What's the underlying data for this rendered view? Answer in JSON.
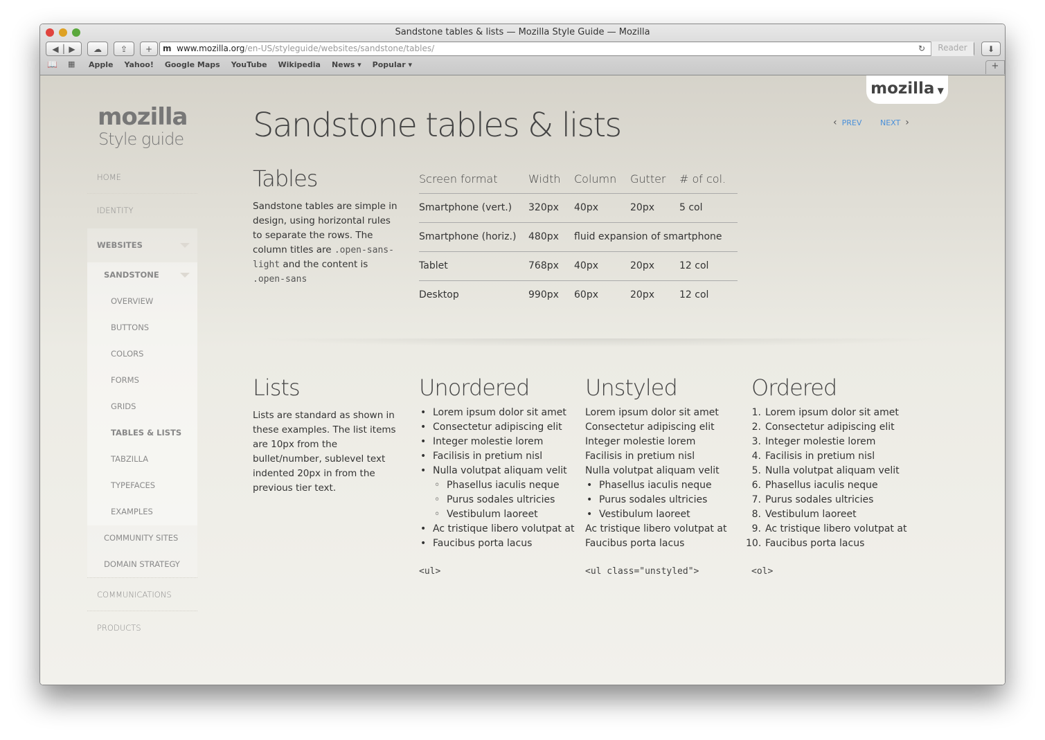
{
  "browser": {
    "title": "Sandstone tables & lists — Mozilla Style Guide — Mozilla",
    "url_domain": "www.mozilla.org",
    "url_path": "/en-US/styleguide/websites/sandstone/tables/",
    "reader": "Reader",
    "bookmarks": [
      "Apple",
      "Yahoo!",
      "Google Maps",
      "YouTube",
      "Wikipedia",
      "News ▾",
      "Popular ▾"
    ]
  },
  "tab": {
    "logo": "mozilla"
  },
  "sidebar": {
    "logo": "mozilla",
    "subtitle": "Style guide",
    "top": [
      "HOME",
      "IDENTITY"
    ],
    "websites": "WEBSITES",
    "sandstone": "SANDSTONE",
    "sandstone_items": [
      "OVERVIEW",
      "BUTTONS",
      "COLORS",
      "FORMS",
      "GRIDS",
      "TABLES & LISTS",
      "TABZILLA",
      "TYPEFACES",
      "EXAMPLES"
    ],
    "websites_items": [
      "COMMUNITY SITES",
      "DOMAIN STRATEGY"
    ],
    "bottom": [
      "COMMUNICATIONS",
      "PRODUCTS"
    ]
  },
  "page": {
    "title": "Sandstone tables & lists",
    "prev": "PREV",
    "next": "NEXT"
  },
  "tables": {
    "heading": "Tables",
    "desc1": "Sandstone tables are simple in design, using horizontal rules to separate the rows. The column titles are ",
    "code1": ".open-sans-light",
    "desc2": " and the content is ",
    "code2": ".open-sans",
    "headers": [
      "Screen format",
      "Width",
      "Column",
      "Gutter",
      "# of col."
    ],
    "rows": [
      [
        "Smartphone (vert.)",
        "320px",
        "40px",
        "20px",
        "5 col"
      ],
      [
        "Smartphone (horiz.)",
        "480px",
        "fluid expansion of smartphone"
      ],
      [
        "Tablet",
        "768px",
        "40px",
        "20px",
        "12 col"
      ],
      [
        "Desktop",
        "990px",
        "60px",
        "20px",
        "12 col"
      ]
    ]
  },
  "lists": {
    "heading": "Lists",
    "desc": "Lists are standard as shown in these examples. The list items are 10px from the bullet/number, sublevel text indented 20px in from the previous tier text.",
    "unordered": "Unordered",
    "unstyled": "Unstyled",
    "ordered": "Ordered",
    "items": [
      "Lorem ipsum dolor sit amet",
      "Consectetur adipiscing elit",
      "Integer molestie lorem",
      "Facilisis in pretium nisl",
      "Nulla volutpat aliquam velit",
      "Phasellus iaculis neque",
      "Purus sodales ultricies",
      "Vestibulum laoreet",
      "Ac tristique libero volutpat at",
      "Faucibus porta lacus"
    ],
    "code_ul": "<ul>",
    "code_unstyled": "<ul class=\"unstyled\">",
    "code_ol": "<ol>"
  }
}
